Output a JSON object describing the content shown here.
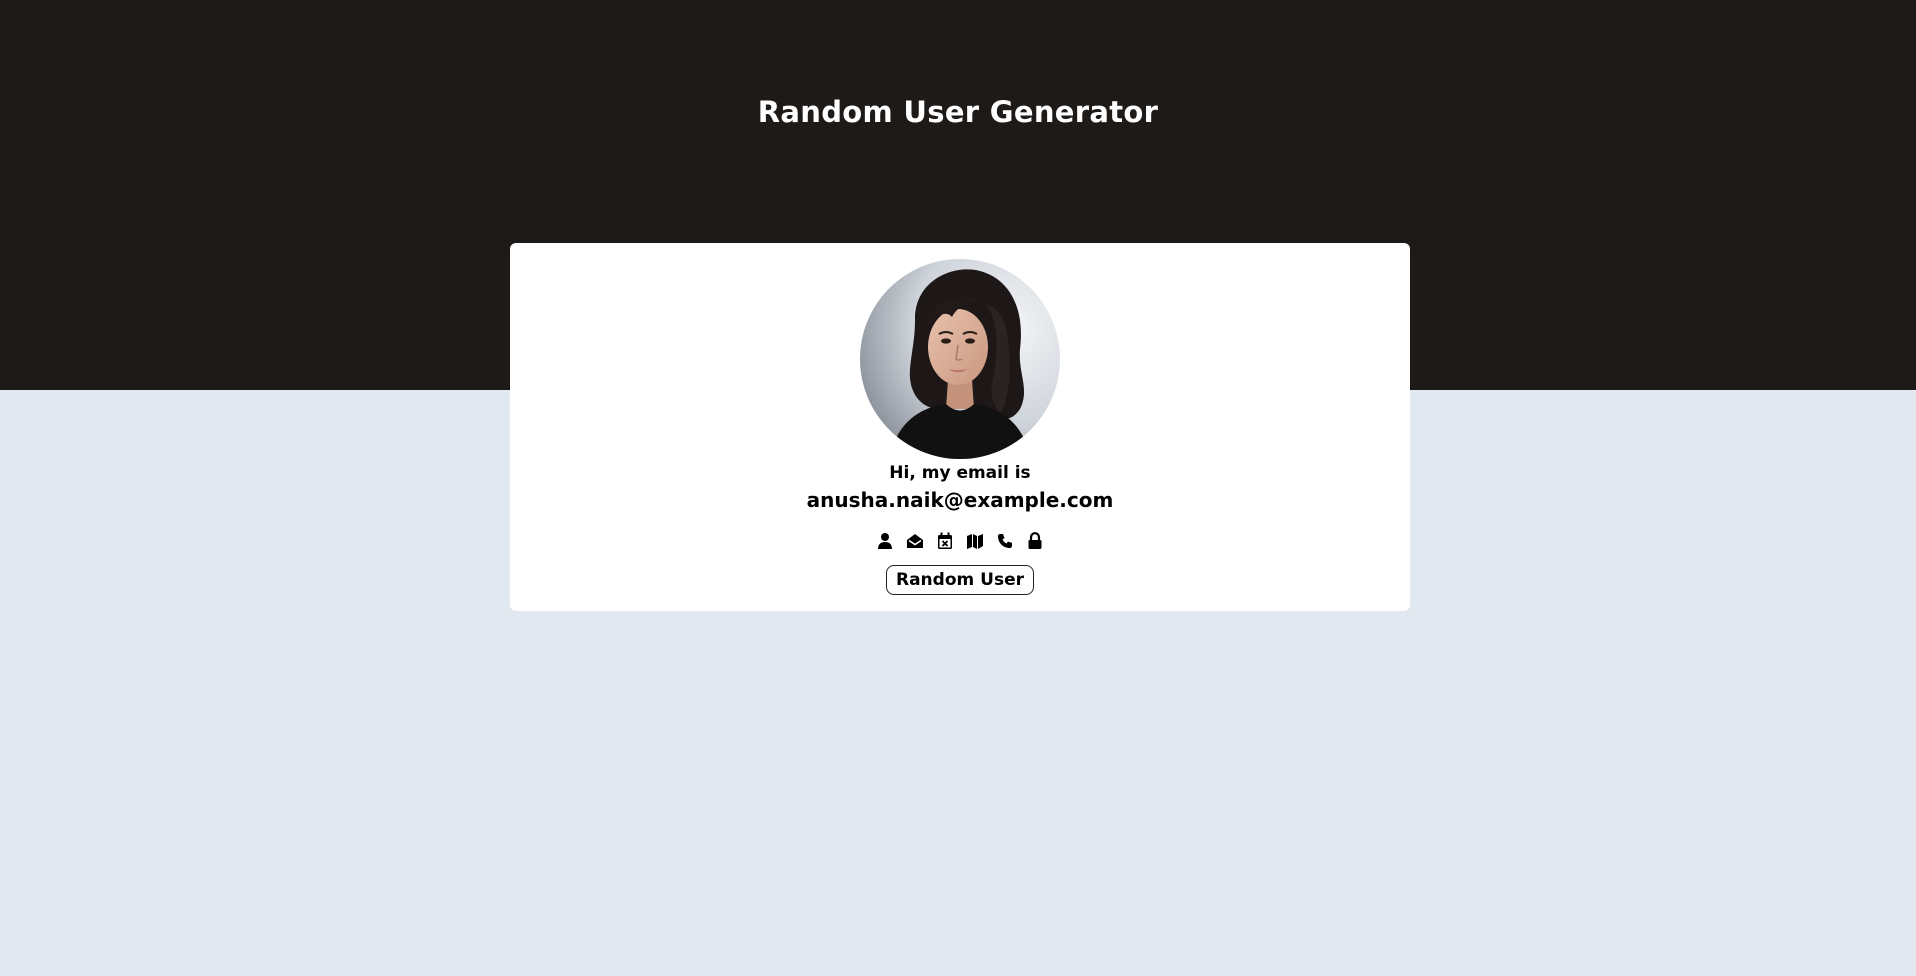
{
  "header": {
    "title": "Random User Generator"
  },
  "card": {
    "greeting": "Hi, my email is",
    "value": "anusha.naik@example.com",
    "info_icons": [
      "user-icon",
      "envelope-open-icon",
      "calendar-icon",
      "map-icon",
      "phone-icon",
      "lock-icon"
    ],
    "button_label": "Random User"
  },
  "colors": {
    "header_bg": "#1e1a18",
    "page_bg": "#e1e8f0",
    "card_bg": "#ffffff",
    "text": "#000000"
  }
}
